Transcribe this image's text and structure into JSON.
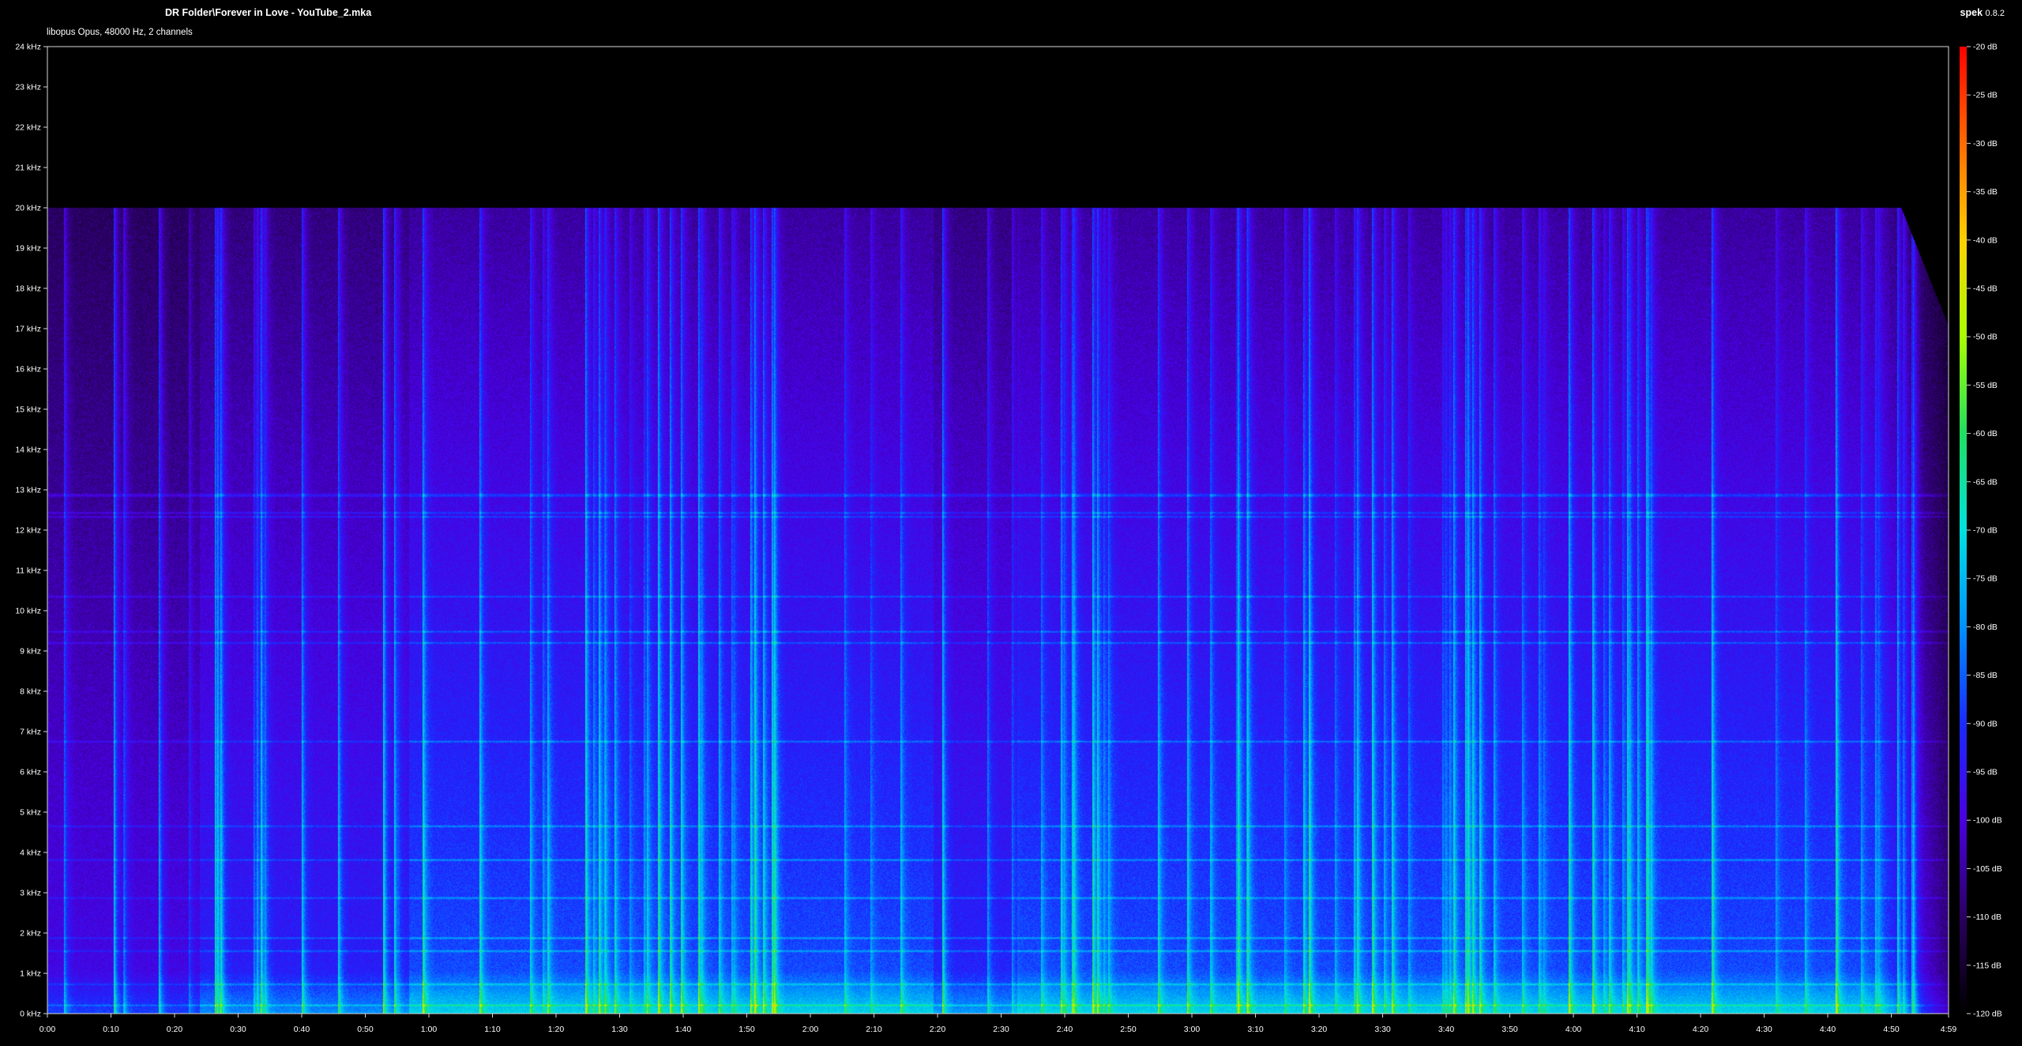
{
  "window": {
    "file_title": "DR Folder\\Forever in Love - YouTube_2.mka",
    "stream_info": "libopus Opus, 48000 Hz, 2 channels",
    "app_name": "spek",
    "app_version": "0.8.2"
  },
  "spectrogram": {
    "duration_label": "4:59",
    "max_frequency_khz": 24,
    "lowpass_cutoff_khz": 20,
    "frequency_ticks": [
      "0 kHz",
      "1 kHz",
      "2 kHz",
      "3 kHz",
      "4 kHz",
      "5 kHz",
      "6 kHz",
      "7 kHz",
      "8 kHz",
      "9 kHz",
      "10 kHz",
      "11 kHz",
      "12 kHz",
      "13 kHz",
      "14 kHz",
      "15 kHz",
      "16 kHz",
      "17 kHz",
      "18 kHz",
      "19 kHz",
      "20 kHz",
      "21 kHz",
      "22 kHz",
      "23 kHz",
      "24 kHz"
    ],
    "time_ticks": [
      "0:00",
      "0:10",
      "0:20",
      "0:30",
      "0:40",
      "0:50",
      "1:00",
      "1:10",
      "1:20",
      "1:30",
      "1:40",
      "1:50",
      "2:00",
      "2:10",
      "2:20",
      "2:30",
      "2:40",
      "2:50",
      "3:00",
      "3:10",
      "3:20",
      "3:30",
      "3:40",
      "3:50",
      "4:00",
      "4:10",
      "4:20",
      "4:30",
      "4:40",
      "4:50",
      "4:59"
    ],
    "db_ticks": [
      "-20 dB",
      "-25 dB",
      "-30 dB",
      "-35 dB",
      "-40 dB",
      "-45 dB",
      "-50 dB",
      "-55 dB",
      "-60 dB",
      "-65 dB",
      "-70 dB",
      "-75 dB",
      "-80 dB",
      "-85 dB",
      "-90 dB",
      "-95 dB",
      "-100 dB",
      "-105 dB",
      "-110 dB",
      "-115 dB",
      "-120 dB"
    ],
    "color_scale": [
      "#ff0000",
      "#ff6a00",
      "#ffd000",
      "#a8ff00",
      "#20e060",
      "#00e0e0",
      "#0090ff",
      "#1a2aff",
      "#4a00e0",
      "#2a0060",
      "#000000"
    ]
  }
}
